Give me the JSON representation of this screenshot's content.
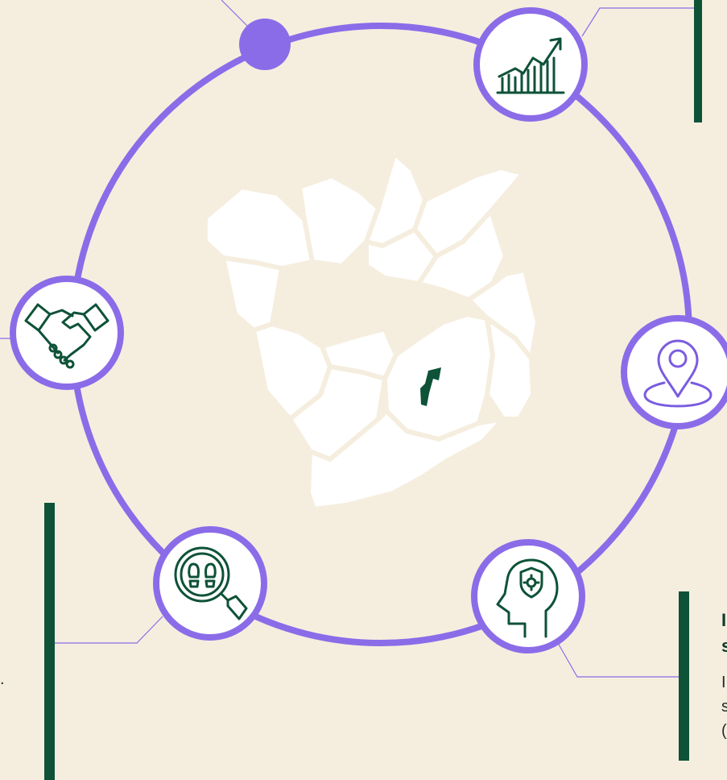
{
  "colors": {
    "background": "#F5EEDF",
    "ring": "#8B6CE8",
    "map_fill": "#FFFFFF",
    "accent_bar": "#0E5238",
    "icon_stroke": "#0E5238",
    "location_icon_stroke": "#7A5CE0",
    "node_dot": "#8B6CE8"
  },
  "icons": [
    "growth-chart-icon",
    "handshake-icon",
    "location-pin-icon",
    "footprints-search-icon",
    "head-gear-shield-icon"
  ],
  "text_fragments": {
    "bottom_left_period": ".",
    "bottom_right_title_line1": "I",
    "bottom_right_title_line2": "s",
    "bottom_right_body_line1": "I",
    "bottom_right_body_line2": "s",
    "bottom_right_body_line3": "("
  }
}
